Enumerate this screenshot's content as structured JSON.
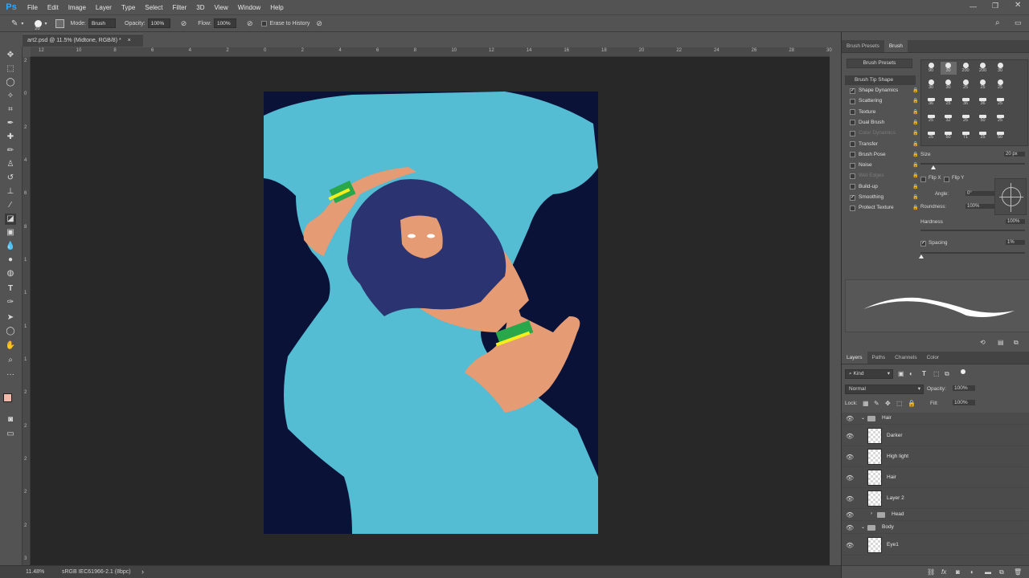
{
  "app": {
    "logo": "Ps"
  },
  "menu": [
    "File",
    "Edit",
    "Image",
    "Layer",
    "Type",
    "Select",
    "Filter",
    "3D",
    "View",
    "Window",
    "Help"
  ],
  "options": {
    "brush_size": "20",
    "mode_label": "Mode:",
    "mode_value": "Brush",
    "opacity_label": "Opacity:",
    "opacity_value": "100%",
    "flow_label": "Flow:",
    "flow_value": "100%",
    "erase_history_label": "Erase to History"
  },
  "document": {
    "tab_title": "art2.psd @ 11.5% (Midtone, RGB/8) *",
    "close": "×"
  },
  "ruler": {
    "top_ticks": [
      "12",
      "10",
      "8",
      "6",
      "4",
      "2",
      "0",
      "2",
      "4",
      "6",
      "8",
      "10",
      "12",
      "14",
      "16",
      "18",
      "20",
      "22",
      "24",
      "26",
      "28",
      "30"
    ],
    "left_ticks": [
      "2",
      "0",
      "2",
      "4",
      "6",
      "8",
      "1",
      "1",
      "1",
      "1",
      "2",
      "2",
      "2",
      "2",
      "2",
      "3"
    ]
  },
  "status": {
    "zoom": "11.48%",
    "profile": "sRGB IEC61966-2.1 (8bpc)",
    "arrow": "›"
  },
  "brush_panel": {
    "tabs": [
      "Brush Presets",
      "Brush"
    ],
    "presets_button": "Brush Presets",
    "tip_shape": "Brush Tip Shape",
    "items": [
      {
        "label": "Shape Dynamics",
        "checked": true,
        "dim": false
      },
      {
        "label": "Scattering",
        "checked": false,
        "dim": false
      },
      {
        "label": "Texture",
        "checked": false,
        "dim": false
      },
      {
        "label": "Dual Brush",
        "checked": false,
        "dim": false
      },
      {
        "label": "Color Dynamics",
        "checked": false,
        "dim": true
      },
      {
        "label": "Transfer",
        "checked": false,
        "dim": false
      },
      {
        "label": "Brush Pose",
        "checked": false,
        "dim": false
      },
      {
        "label": "Noise",
        "checked": false,
        "dim": false
      },
      {
        "label": "Wet Edges",
        "checked": false,
        "dim": true
      },
      {
        "label": "Build-up",
        "checked": false,
        "dim": false
      },
      {
        "label": "Smoothing",
        "checked": true,
        "dim": false
      },
      {
        "label": "Protect Texture",
        "checked": false,
        "dim": false
      }
    ],
    "tip_sizes": [
      "90",
      "30",
      "200",
      "200",
      "30",
      "30",
      "30",
      "25",
      "25",
      "25",
      "36",
      "25",
      "36",
      "36",
      "25",
      "25",
      "32",
      "25",
      "50",
      "25",
      "25",
      "50",
      "71",
      "25",
      "50",
      "50"
    ],
    "size_label": "Size",
    "size_value": "20 px",
    "flipx_label": "Flip X",
    "flipy_label": "Flip Y",
    "angle_label": "Angle:",
    "angle_value": "0°",
    "roundness_label": "Roundness:",
    "roundness_value": "100%",
    "hardness_label": "Hardness",
    "hardness_value": "100%",
    "spacing_label": "Spacing",
    "spacing_value": "1%",
    "size_fraction": 0.12,
    "spacing_fraction": 0.01
  },
  "layers_panel": {
    "tabs": [
      "Layers",
      "Paths",
      "Channels",
      "Color"
    ],
    "kind_label": "Kind",
    "blend_mode": "Normal",
    "opacity_label": "Opacity:",
    "opacity_value": "100%",
    "lock_label": "Lock:",
    "fill_label": "Fill:",
    "fill_value": "100%",
    "rows": [
      {
        "type": "group",
        "name": "Hair",
        "indent": 1
      },
      {
        "type": "layer",
        "name": "Darker"
      },
      {
        "type": "layer",
        "name": "High light"
      },
      {
        "type": "layer",
        "name": "Hair"
      },
      {
        "type": "layer",
        "name": "Layer 2"
      },
      {
        "type": "group",
        "name": "Head",
        "indent": 2
      },
      {
        "type": "group",
        "name": "Body",
        "indent": 1
      },
      {
        "type": "layer",
        "name": "Eye1"
      }
    ]
  },
  "colors": {
    "canvas_bg": "#282828",
    "art_dark": "#0a1238",
    "art_cyan": "#54bcd3",
    "skin": "#e59b73",
    "hair": "#2b3470",
    "bracelet_green": "#28a84a",
    "bracelet_yellow": "#f2ef1c",
    "foreground_swatch": "#f2b8a9",
    "background_swatch": "#ffffff"
  }
}
